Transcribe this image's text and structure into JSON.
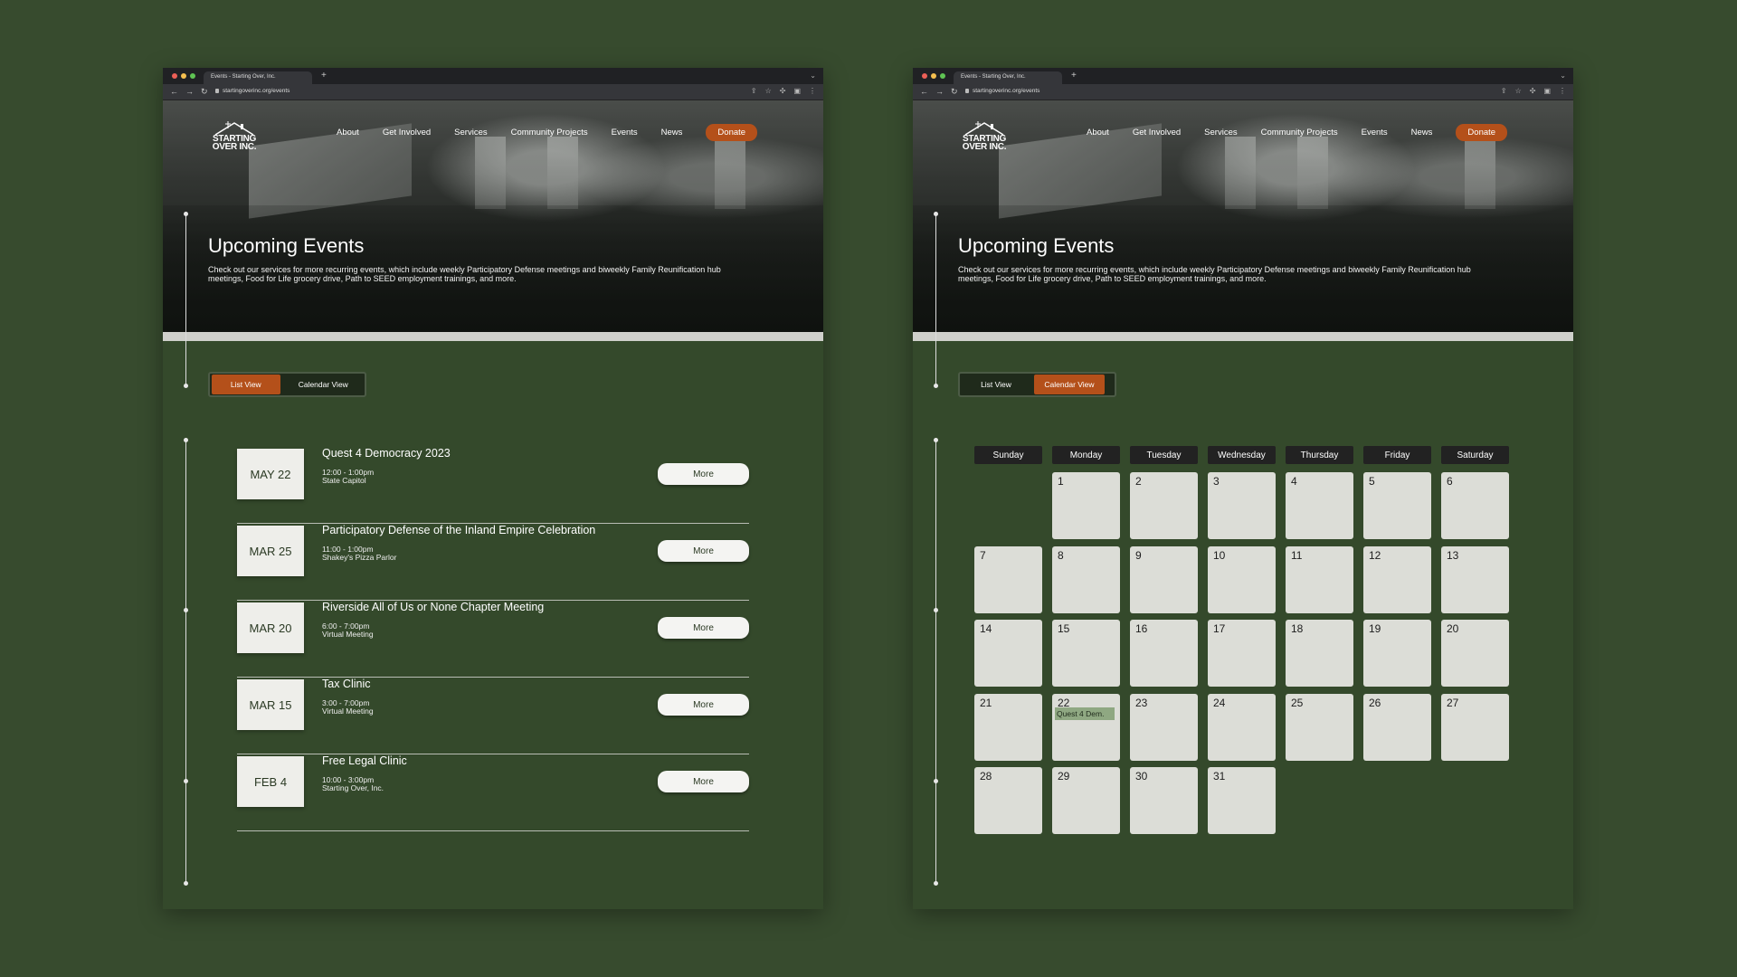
{
  "browser": {
    "tab_title": "Events - Starting Over, Inc.",
    "url": "startingoverinc.org/events"
  },
  "site": {
    "logo_line1": "STARTING",
    "logo_line2": "OVER INC.",
    "nav": [
      "About",
      "Get Involved",
      "Services",
      "Community Projects",
      "Events",
      "News"
    ],
    "donate_label": "Donate"
  },
  "hero": {
    "title": "Upcoming Events",
    "description": "Check out our services for more recurring events, which include weekly Participatory Defense meetings and biweekly Family Reunification hub meetings, Food for Life grocery drive, Path to SEED employment trainings, and more."
  },
  "view_toggle": {
    "list_label": "List View",
    "calendar_label": "Calendar View"
  },
  "left_window": {
    "active_view": "list"
  },
  "right_window": {
    "active_view": "calendar"
  },
  "events": [
    {
      "date": "MAY 22",
      "title": "Quest 4 Democracy 2023",
      "time": "12:00 - 1:00pm",
      "location": "State Capitol",
      "button": "More"
    },
    {
      "date": "MAR 25",
      "title": "Participatory Defense of the Inland Empire Celebration",
      "time": "11:00 - 1:00pm",
      "location": "Shakey's Pizza Parlor",
      "button": "More"
    },
    {
      "date": "MAR 20",
      "title": "Riverside All of Us or None Chapter Meeting",
      "time": "6:00 - 7:00pm",
      "location": "Virtual Meeting",
      "button": "More"
    },
    {
      "date": "MAR 15",
      "title": "Tax Clinic",
      "time": "3:00 - 7:00pm",
      "location": "Virtual Meeting",
      "button": "More"
    },
    {
      "date": "FEB 4",
      "title": "Free Legal Clinic",
      "time": "10:00 - 3:00pm",
      "location": "Starting Over, Inc.",
      "button": "More"
    }
  ],
  "calendar": {
    "weekdays": [
      "Sunday",
      "Monday",
      "Tuesday",
      "Wednesday",
      "Thursday",
      "Friday",
      "Saturday"
    ],
    "first_weekday_index": 1,
    "days_in_month": 31,
    "events": [
      {
        "day": 22,
        "label": "Quest 4 Dem."
      }
    ]
  },
  "colors": {
    "background": "#374b2e",
    "panel": "#34492b",
    "accent": "#b4501a",
    "calendar_cell": "#dcddd7",
    "calendar_event": "#8fa882"
  },
  "icons": {
    "nav": [
      "back-arrow-icon",
      "forward-arrow-icon",
      "reload-icon"
    ],
    "toolbar": [
      "share-icon",
      "star-icon",
      "extensions-icon",
      "sidepanel-icon",
      "menu-dots-icon"
    ]
  }
}
